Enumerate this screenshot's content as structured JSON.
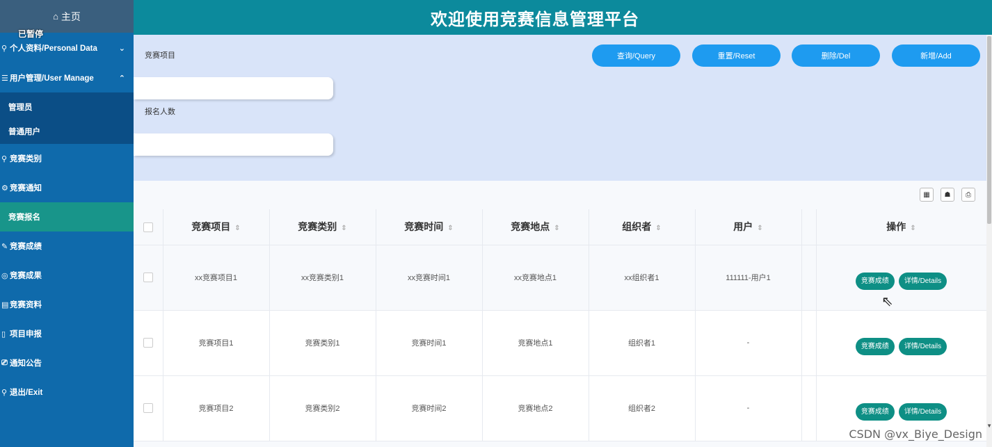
{
  "sidebar": {
    "home_icon": "⌂",
    "home_label": "主页",
    "paused_label": "已暂停",
    "items": [
      {
        "label": "个人资料/Personal Data",
        "icon": "⚲",
        "chevron": "⌄"
      },
      {
        "label": "用户管理/User Manage",
        "icon": "☰",
        "chevron": "⌃"
      },
      {
        "label": "管理员"
      },
      {
        "label": "普通用户"
      },
      {
        "label": "竞赛类别",
        "icon": "⚲"
      },
      {
        "label": "竞赛通知",
        "icon": "⚙"
      },
      {
        "label": "竞赛报名"
      },
      {
        "label": "竞赛成绩",
        "icon": "✎"
      },
      {
        "label": "竞赛成果",
        "icon": "◎"
      },
      {
        "label": "竞赛资料",
        "icon": "▤"
      },
      {
        "label": "项目申报",
        "icon": "▯"
      },
      {
        "label": "通知公告",
        "icon": "⎚"
      },
      {
        "label": "退出/Exit",
        "icon": "⚲"
      }
    ]
  },
  "header": {
    "title": "欢迎使用竞赛信息管理平台"
  },
  "search": {
    "field1_label": "竞赛项目",
    "field2_label": "报名人数",
    "buttons": [
      "查询/Query",
      "重置/Reset",
      "删除/Del",
      "新增/Add"
    ]
  },
  "toolbar_icons": [
    "▦",
    "☗",
    "⎙"
  ],
  "table": {
    "columns": [
      "竞赛项目",
      "竞赛类别",
      "竞赛时间",
      "竞赛地点",
      "组织者",
      "用户",
      "操作"
    ],
    "sort_glyph": "⇕",
    "rows": [
      [
        "xx竞赛项目1",
        "xx竞赛类别1",
        "xx竞赛时间1",
        "xx竞赛地点1",
        "xx组织者1",
        "111111-用户1"
      ],
      [
        "竞赛项目1",
        "竞赛类别1",
        "竞赛时间1",
        "竞赛地点1",
        "组织者1",
        "-"
      ],
      [
        "竞赛项目2",
        "竞赛类别2",
        "竞赛时间2",
        "竞赛地点2",
        "组织者2",
        "-"
      ]
    ],
    "op_buttons": [
      "竞赛成绩",
      "详情/Details"
    ]
  },
  "watermark": "CSDN @vx_Biye_Design"
}
